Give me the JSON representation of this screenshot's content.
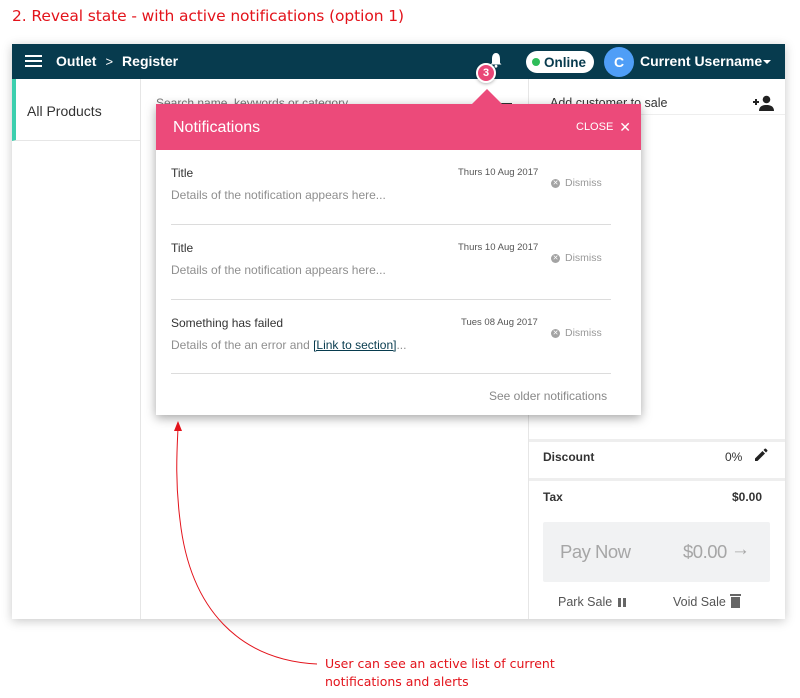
{
  "caption": "2. Reveal state - with active notifications (option 1)",
  "topbar": {
    "menu_icon": "hamburger-icon",
    "breadcrumb": [
      "Outlet",
      "Register"
    ],
    "breadcrumb_separator": ">",
    "notification_icon": "bell-icon",
    "notification_count": "3",
    "status": "Online",
    "avatar_initial": "C",
    "username": "Current Username",
    "user_menu_icon": "caret-down-icon"
  },
  "sidebar": {
    "items": [
      {
        "label": "All Products",
        "active": true
      }
    ]
  },
  "main": {
    "search_placeholder": "Search name, keywords or category"
  },
  "cart": {
    "add_customer_label": "Add customer to sale",
    "add_customer_icon": "add-person-icon",
    "discount_label": "Discount",
    "discount_value": "0%",
    "tax_label": "Tax",
    "tax_value": "$0.00",
    "pay_label": "Pay Now",
    "pay_amount": "$0.00",
    "pay_arrow": "→",
    "park_label": "Park Sale",
    "void_label": "Void Sale"
  },
  "notifications": {
    "title": "Notifications",
    "close_label": "CLOSE",
    "close_icon": "✕",
    "dismiss_label": "Dismiss",
    "items": [
      {
        "title": "Title",
        "date": "Thurs 10 Aug 2017",
        "detail": "Details of the notification appears here..."
      },
      {
        "title": "Title",
        "date": "Thurs 10 Aug 2017",
        "detail": "Details of the notification appears here..."
      },
      {
        "title": "Something has failed",
        "date": "Tues 08 Aug 2017",
        "detail_prefix": "Details of the an error and ",
        "link_text": "[Link to section]",
        "detail_suffix": "..."
      }
    ],
    "see_older_label": "See older notifications"
  },
  "annotation": {
    "text": "User can see an active list of current notifications and alerts"
  },
  "colors": {
    "topbar": "#073b4e",
    "notification_accent": "#ec4a7a",
    "online_dot": "#2ebd59",
    "avatar": "#4f9ef7",
    "sidebar_active": "#3ccfae",
    "annotation": "#e3131b"
  }
}
